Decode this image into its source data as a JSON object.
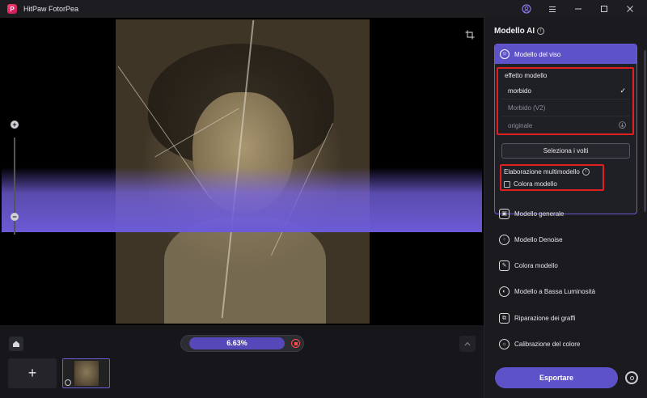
{
  "window": {
    "title": "HitPaw FotorPea",
    "logo_letter": "P",
    "icons": [
      "user-icon",
      "menu-icon",
      "minimize-icon",
      "maximize-icon",
      "close-icon"
    ]
  },
  "canvas": {
    "progress_value": 6.63,
    "progress_text": "6.63%"
  },
  "panel": {
    "title": "Modello AI",
    "face_model": {
      "label": "Modello del viso",
      "effect_label": "effetto modello",
      "options": [
        {
          "label": "morbido",
          "selected": true
        },
        {
          "label": "Morbido (V2)",
          "selected": false
        },
        {
          "label": "originale",
          "selected": false
        }
      ],
      "select_faces_label": "Seleziona i volti",
      "multi_label": "Elaborazione multimodello",
      "colorize_checkbox_label": "Colora modello",
      "colorize_checked": false
    },
    "models": [
      {
        "label": "Modello generale",
        "icon": "image-icon"
      },
      {
        "label": "Modello Denoise",
        "icon": "denoise-icon"
      },
      {
        "label": "Colora modello",
        "icon": "palette-icon"
      },
      {
        "label": "Modello a Bassa Luminosità",
        "icon": "half-circle-icon"
      },
      {
        "label": "Riparazione dei graffi",
        "icon": "scratch-repair-icon"
      },
      {
        "label": "Calibrazione del colore",
        "icon": "sun-icon"
      }
    ],
    "export_label": "Esportare"
  },
  "colors": {
    "accent": "#5e52c9",
    "highlight_border": "#e02020",
    "background": "#111114",
    "panel": "#1a1a1f"
  }
}
